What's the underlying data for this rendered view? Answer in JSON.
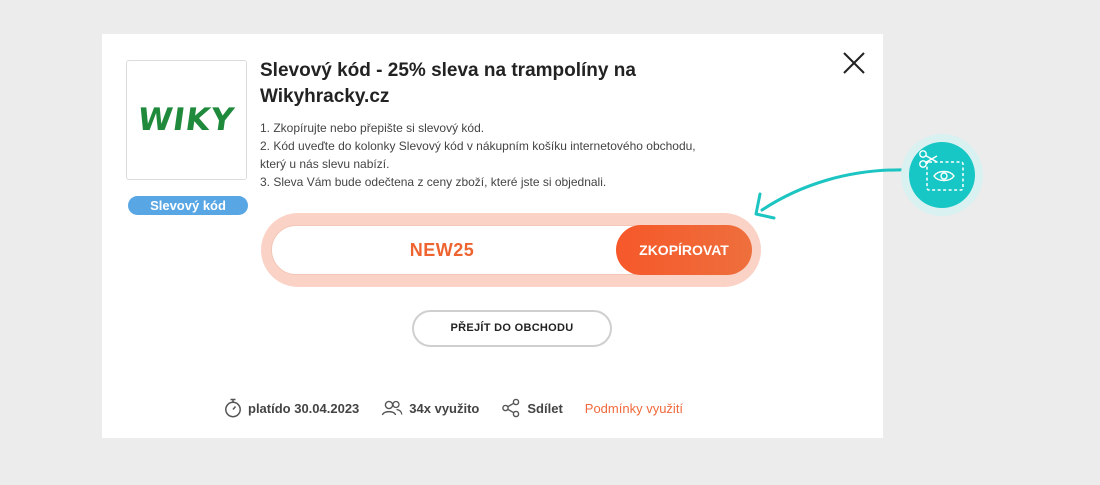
{
  "store": {
    "logo_text": "WIKY",
    "type_badge": "Slevový kód"
  },
  "coupon": {
    "title": "Slevový kód - 25% sleva na trampolíny na Wikyhracky.cz",
    "instructions": [
      "1. Zkopírujte nebo přepište si slevový kód.",
      "2. Kód uveďte do kolonky Slevový kód v nákupním košíku internetového obchodu, který u nás slevu nabízí.",
      "3. Sleva Vám bude odečtena z ceny zboží, které jste si objednali."
    ],
    "code": "NEW25",
    "copy_label": "ZKOPÍROVAT",
    "shop_label": "PŘEJÍT DO OBCHODU"
  },
  "footer": {
    "valid": "platído 30.04.2023",
    "used": "34x využito",
    "share": "Sdílet",
    "terms": "Podmínky využití"
  },
  "icons": {
    "close": "close-icon",
    "stopwatch": "stopwatch-icon",
    "users": "users-icon",
    "share": "share-icon",
    "scissors": "scissors-coupon-icon",
    "arrow": "curved-arrow-icon"
  },
  "colors": {
    "accent": "#ee6430",
    "badge_blue": "#58a6e3",
    "teal": "#17c7c5",
    "brand_green": "#1f8a3c"
  }
}
